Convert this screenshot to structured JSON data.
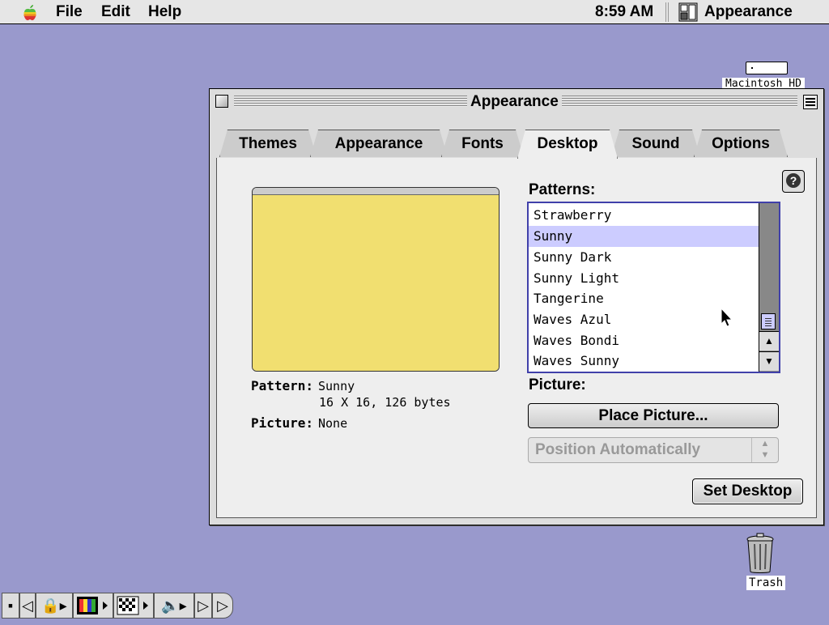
{
  "menubar": {
    "items": [
      "File",
      "Edit",
      "Help"
    ],
    "clock": "8:59 AM",
    "app_name": "Appearance"
  },
  "desktop": {
    "hd_label": "Macintosh HD",
    "trash_label": "Trash"
  },
  "window": {
    "title": "Appearance",
    "tabs": [
      "Themes",
      "Appearance",
      "Fonts",
      "Desktop",
      "Sound",
      "Options"
    ],
    "active_tab": "Desktop",
    "help": "?",
    "pattern_label": "Pattern:",
    "pattern_value": "Sunny",
    "pattern_detail": "16 X 16, 126 bytes",
    "picture_label": "Picture:",
    "picture_value": "None",
    "patterns_heading": "Patterns:",
    "patterns": [
      "Strawberry",
      "Sunny",
      "Sunny Dark",
      "Sunny Light",
      "Tangerine",
      "Waves Azul",
      "Waves Bondi",
      "Waves Sunny"
    ],
    "selected_pattern": "Sunny",
    "picture_heading": "Picture:",
    "place_picture_label": "Place Picture...",
    "position_select": "Position Automatically",
    "set_desktop_label": "Set Desktop",
    "preview_color": "#f1df70"
  },
  "colors": {
    "desktop": "#9999cc",
    "selection": "#ccccff",
    "list_border": "#4040aa"
  },
  "control_strip": {
    "icons": [
      "collapse-icon",
      "left-arrow-icon",
      "lock-icon",
      "monitor-colors-icon",
      "checkerboard-icon",
      "speaker-icon",
      "right-arrow-icon",
      "tab-end-icon"
    ]
  }
}
